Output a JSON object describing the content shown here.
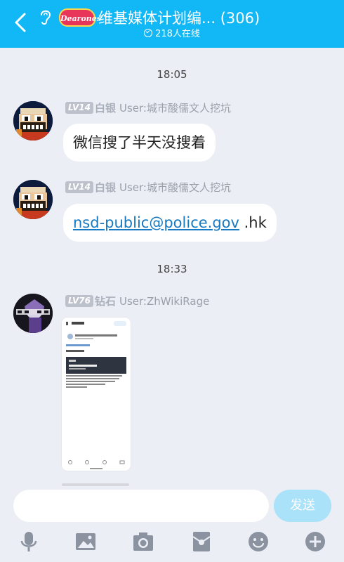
{
  "header": {
    "logo_text": "Dearones",
    "title": "维基媒体计划编...",
    "member_count": "(306)",
    "online_status": "218人在线"
  },
  "messages": [
    {
      "timestamp": "18:05",
      "level": "LV14",
      "rank": "白银",
      "sender": "User:城市酸儒文人挖坑",
      "text": "微信搜了半天没搜着"
    },
    {
      "level": "LV14",
      "rank": "白银",
      "sender": "User:城市酸儒文人挖坑",
      "link_text": "nsd-public@police.gov",
      "suffix_text": " .hk"
    },
    {
      "timestamp": "18:33",
      "level": "LV76",
      "rank": "钻石",
      "sender": "User:ZhWikiRage",
      "attachment": "screenshot-image"
    }
  ],
  "composer": {
    "input_value": "",
    "input_placeholder": "",
    "send_label": "发送"
  },
  "toolbar_icons": [
    "microphone-icon",
    "image-icon",
    "camera-icon",
    "red-packet-icon",
    "emoji-icon",
    "plus-icon"
  ],
  "colors": {
    "header_bg": "#12b7f5",
    "send_bg": "#a9e2f9",
    "link": "#1779c2"
  }
}
